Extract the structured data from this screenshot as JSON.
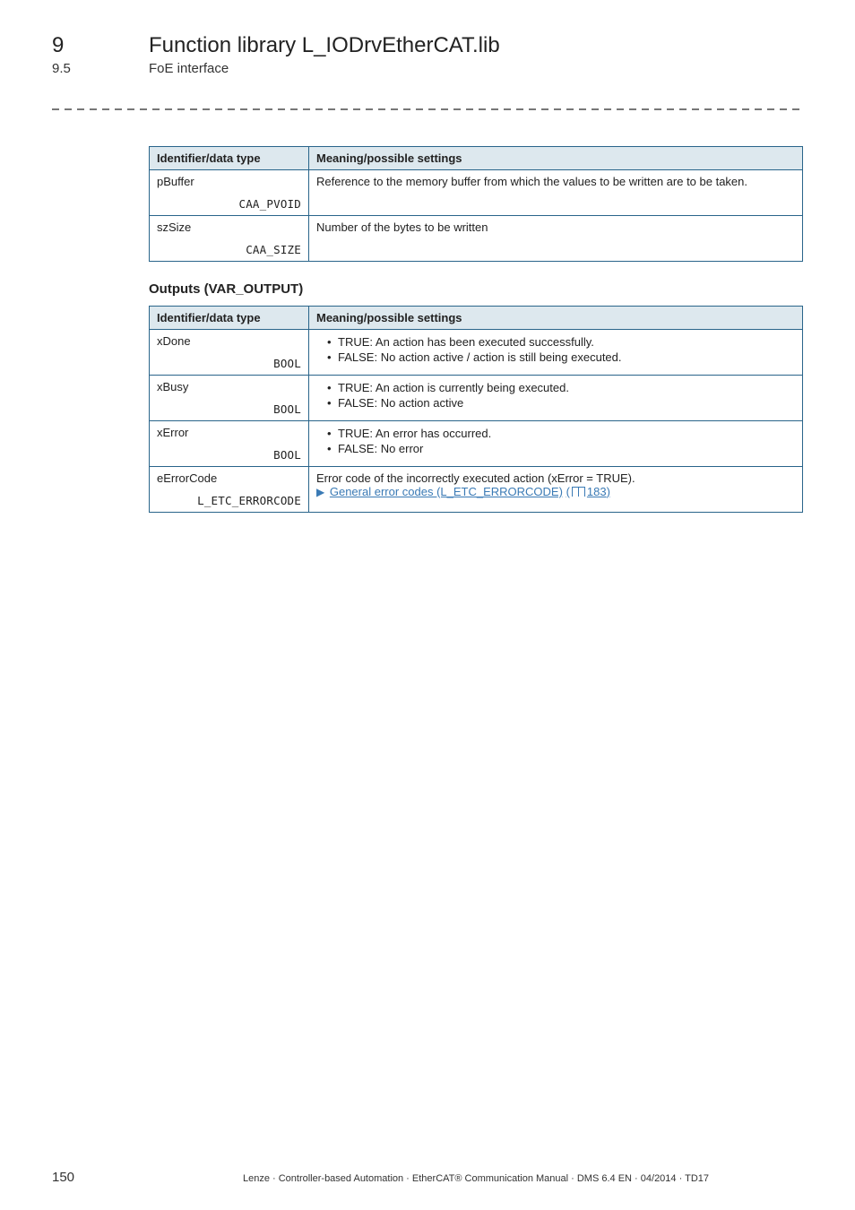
{
  "header": {
    "section_num": "9",
    "section_title": "Function library L_IODrvEtherCAT.lib",
    "subsection_num": "9.5",
    "subsection_title": "FoE interface"
  },
  "tables": {
    "inputs": {
      "columns": {
        "id": "Identifier/data type",
        "meaning": "Meaning/possible settings"
      },
      "rows": [
        {
          "name": "pBuffer",
          "type": "CAA_PVOID",
          "meaning_text": "Reference to the memory buffer from which the values to be written are to be taken."
        },
        {
          "name": "szSize",
          "type": "CAA_SIZE",
          "meaning_text": "Number of the bytes to be written"
        }
      ]
    },
    "outputs_heading": "Outputs (VAR_OUTPUT)",
    "outputs": {
      "columns": {
        "id": "Identifier/data type",
        "meaning": "Meaning/possible settings"
      },
      "rows": [
        {
          "name": "xDone",
          "type": "BOOL",
          "bullets": [
            "TRUE: An action has been executed successfully.",
            "FALSE: No action active / action is still being executed."
          ]
        },
        {
          "name": "xBusy",
          "type": "BOOL",
          "bullets": [
            "TRUE: An action is currently being executed.",
            "FALSE: No action active"
          ]
        },
        {
          "name": "xError",
          "type": "BOOL",
          "bullets": [
            "TRUE: An error has occurred.",
            "FALSE: No error"
          ]
        },
        {
          "name": "eErrorCode",
          "type": "L_ETC_ERRORCODE",
          "error_text": "Error code of the incorrectly executed action (xError = TRUE).",
          "link_text": "General error codes (L_ETC_ERRORCODE)",
          "page_ref": "183"
        }
      ]
    }
  },
  "footer": {
    "page_num": "150",
    "text": "Lenze · Controller-based Automation · EtherCAT® Communication Manual · DMS 6.4 EN · 04/2014 · TD17"
  }
}
